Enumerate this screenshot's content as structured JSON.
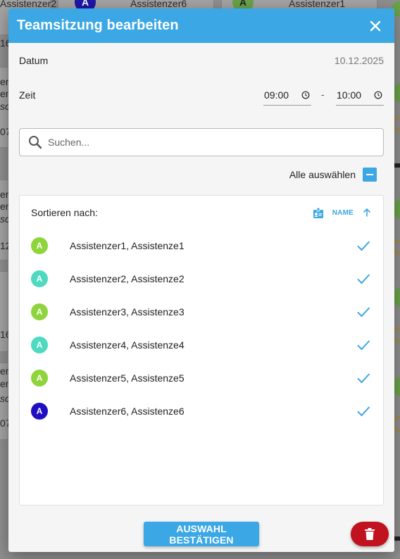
{
  "background": {
    "cards": [
      {
        "name": "Assistenzer2",
        "initial": "A",
        "color": "#cfcfcf"
      },
      {
        "name": "Assistenzer6",
        "initial": "A",
        "color": "#1e16a8"
      },
      {
        "name": "Assistenzer1",
        "initial": "A",
        "color": "#6aa34a"
      }
    ],
    "fragments": [
      "er",
      "en",
      "sch",
      "16",
      "07",
      "12",
      "er",
      "en",
      "sch",
      "16",
      "er",
      "en",
      "sc",
      "07"
    ]
  },
  "dialog": {
    "title": "Teamsitzung bearbeiten",
    "close_icon": "close-icon",
    "date_label": "Datum",
    "date_value": "10.12.2025",
    "time_label": "Zeit",
    "time_start": "09:00",
    "time_separator": "-",
    "time_end": "10:00",
    "search_placeholder": "Suchen...",
    "select_all_label": "Alle auswählen",
    "sort_label": "Sortieren nach:",
    "sort_field": "NAME",
    "persons": [
      {
        "initial": "A",
        "name": "Assistenzer1, Assistenze1",
        "color": "#8fd43c",
        "selected": true
      },
      {
        "initial": "A",
        "name": "Assistenzer2, Assistenze2",
        "color": "#4fd9c0",
        "selected": true
      },
      {
        "initial": "A",
        "name": "Assistenzer3, Assistenze3",
        "color": "#8fd43c",
        "selected": true
      },
      {
        "initial": "A",
        "name": "Assistenzer4, Assistenze4",
        "color": "#4fd9c0",
        "selected": true
      },
      {
        "initial": "A",
        "name": "Assistenzer5, Assistenze5",
        "color": "#8fd43c",
        "selected": true
      },
      {
        "initial": "A",
        "name": "Assistenzer6, Assistenze6",
        "color": "#1e0fc2",
        "selected": true
      }
    ],
    "confirm_label": "AUSWAHL BESTÄTIGEN"
  },
  "colors": {
    "accent": "#3ba7e4",
    "danger": "#c1121f"
  }
}
